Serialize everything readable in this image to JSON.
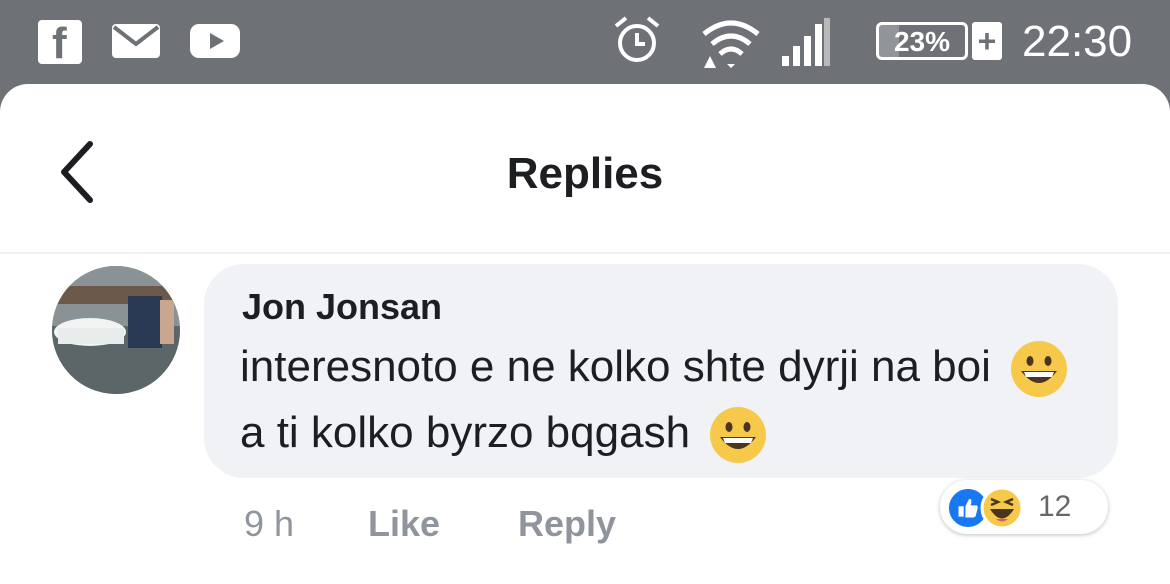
{
  "status_bar": {
    "icons": [
      "facebook-icon",
      "mail-icon",
      "youtube-icon",
      "alarm-icon",
      "wifi-icon",
      "signal-icon",
      "battery-icon"
    ],
    "battery_percent": "23%",
    "battery_level": 0.23,
    "charge_symbol": "+",
    "time": "22:30"
  },
  "header": {
    "back_icon": "chevron-left-icon",
    "title": "Replies"
  },
  "comment": {
    "author": "Jon Jonsan",
    "text_part1": "interesnoto e ne kolko shte dyrji na boi",
    "text_part2": "a ti kolko byrzo bqgash",
    "emoji": "grinning-face-emoji",
    "time": "9 h",
    "like_label": "Like",
    "reply_label": "Reply",
    "reactions": {
      "types": [
        "like-reaction",
        "haha-reaction"
      ],
      "count": "12"
    }
  },
  "colors": {
    "status_bar_bg": "#6e7276",
    "bubble_bg": "#f0f2f5",
    "like_blue": "#1877f2",
    "meta_gray": "#90949c"
  }
}
